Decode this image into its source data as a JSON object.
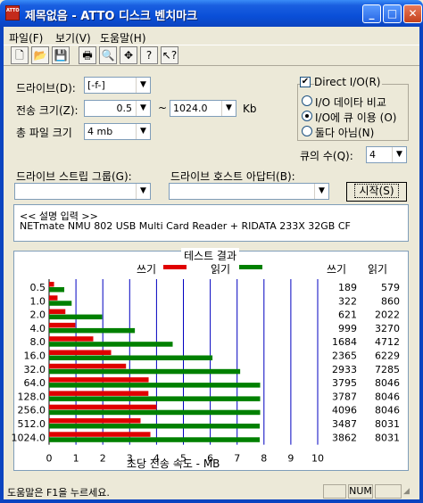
{
  "window": {
    "icon_text": "ATTO",
    "title": "제목없음 - ATTO 디스크 벤치마크",
    "minimize_glyph": "_",
    "maximize_glyph": "□",
    "close_glyph": "✕"
  },
  "menu": [
    {
      "label": "파일(F)"
    },
    {
      "label": "보기(V)"
    },
    {
      "label": "도움말(H)"
    }
  ],
  "toolbar": [
    {
      "icon": "new-file-icon",
      "glyph": "🗋"
    },
    {
      "icon": "open-folder-icon",
      "glyph": "📂"
    },
    {
      "icon": "save-icon",
      "glyph": "💾"
    },
    {
      "icon": "print-icon",
      "glyph": "🖶"
    },
    {
      "icon": "print-preview-icon",
      "glyph": "🔍"
    },
    {
      "icon": "move-icon",
      "glyph": "✥"
    },
    {
      "icon": "help-icon",
      "glyph": "?"
    },
    {
      "icon": "context-help-icon",
      "glyph": "↖?"
    }
  ],
  "settings": {
    "drive_label": "드라이브(D):",
    "drive_value": "[-f-]",
    "transfer_size_label": "전송 크기(Z):",
    "transfer_from": "0.5",
    "transfer_sep": "~",
    "transfer_to": "1024.0",
    "transfer_unit": "Kb",
    "total_size_label": "총 파일 크기",
    "total_size_value": "4 mb",
    "direct_io_label": "Direct I/O(R)",
    "direct_io_checked": true,
    "io_compare_label": "I/O 데이타 비교",
    "io_queue_label": "I/O에 큐 이용 (O)",
    "neither_label": "둘다 아님(N)",
    "queue_count_label": "큐의 수(Q):",
    "queue_count_value": "4",
    "stream_group_label": "드라이브 스트립 그룹(G):",
    "stream_group_value": "",
    "host_adapter_label": "드라이브 호스트 아답터(B):",
    "host_adapter_value": "",
    "start_button": "시작(S)"
  },
  "description": {
    "line1": "<< 설명 입력 >>",
    "line2": "NETmate NMU 802 USB Multi Card Reader + RIDATA 233X 32GB CF"
  },
  "chart_data": {
    "type": "bar",
    "title": "테스트 결과",
    "xlabel": "초당 전송 속도 - MB",
    "ylabel": "",
    "xlim": [
      0,
      10
    ],
    "x_ticks": [
      "0",
      "1",
      "2",
      "3",
      "4",
      "5",
      "6",
      "7",
      "8",
      "9",
      "10"
    ],
    "categories": [
      "0.5",
      "1.0",
      "2.0",
      "4.0",
      "8.0",
      "16.0",
      "32.0",
      "64.0",
      "128.0",
      "256.0",
      "512.0",
      "1024.0"
    ],
    "series": [
      {
        "name": "쓰기",
        "color": "#e00000",
        "values": [
          189,
          322,
          621,
          999,
          1684,
          2365,
          2933,
          3795,
          3787,
          4096,
          3487,
          3862
        ]
      },
      {
        "name": "읽기",
        "color": "#008000",
        "values": [
          579,
          860,
          2022,
          3270,
          4712,
          6229,
          7285,
          8046,
          8046,
          8046,
          8031,
          8031
        ]
      }
    ],
    "value_headers": {
      "write": "쓰기",
      "read": "읽기"
    },
    "grid_color": "#0000c0",
    "grid": true
  },
  "status": {
    "help_text": "도움말은 F1을 누르세요.",
    "num": "NUM"
  }
}
